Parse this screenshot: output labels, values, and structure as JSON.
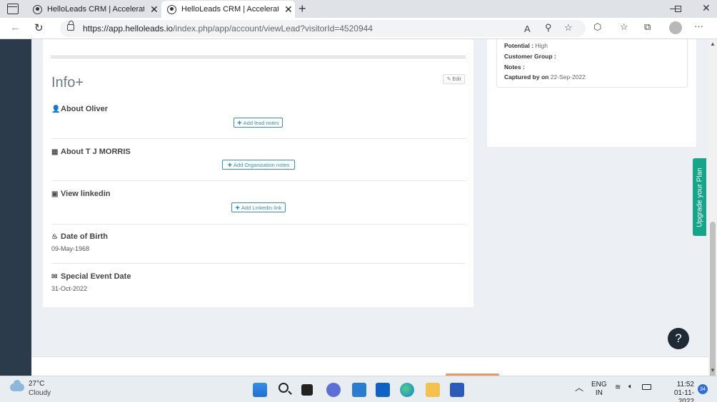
{
  "browser": {
    "tabs": [
      {
        "title": "HelloLeads CRM | Accelerate You"
      },
      {
        "title": "HelloLeads CRM | Accelerate You"
      }
    ],
    "url_host": "https://app.helloleads.io",
    "url_path": "/index.php/app/account/viewLead?visitorId=4520944"
  },
  "info": {
    "title": "Info+",
    "edit_label": "Edit",
    "sections": [
      {
        "title": "About Oliver",
        "button": "Add lead notes"
      },
      {
        "title": "About T J MORRIS",
        "button": "Add Organization notes"
      },
      {
        "title": "View linkedin",
        "button": "Add Linkedin link"
      },
      {
        "title": "Date of Birth",
        "value": "09-May-1968"
      },
      {
        "title": "Special Event Date",
        "value": "31-Oct-2022"
      }
    ]
  },
  "lead_details": {
    "potential_label": "Potential :",
    "potential_value": "High",
    "customer_group_label": "Customer Group :",
    "notes_label": "Notes :",
    "captured_label": "Captured by on",
    "captured_value": "22-Sep-2022"
  },
  "upgrade_label": "Upgrade your Plan",
  "help_label": "?",
  "taskbar": {
    "temperature": "27°C",
    "weather": "Cloudy",
    "language_top": "ENG",
    "language_bottom": "IN",
    "time": "11:52",
    "date": "01-11-2022",
    "notification_count": "34"
  }
}
